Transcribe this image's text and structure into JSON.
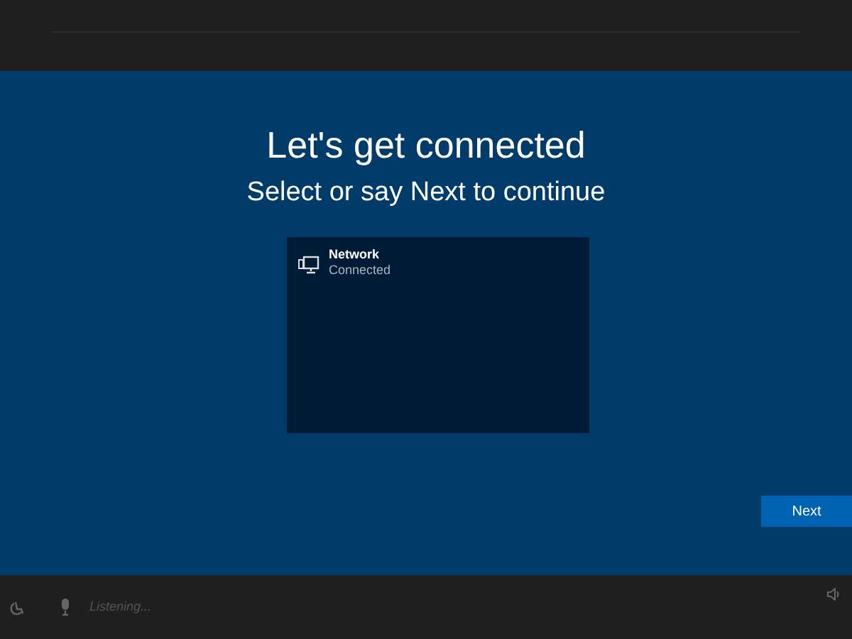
{
  "heading": "Let's get connected",
  "subheading": "Select or say Next to continue",
  "networks": [
    {
      "name": "Network",
      "status": "Connected"
    }
  ],
  "next_button": "Next",
  "voice": {
    "placeholder": "Listening..."
  }
}
